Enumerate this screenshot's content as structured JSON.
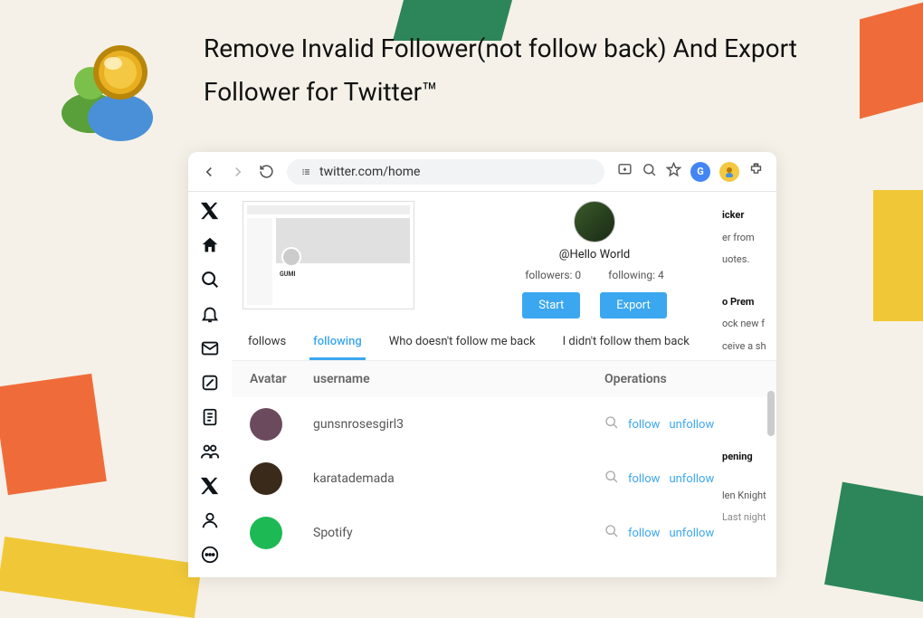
{
  "headline": "Remove Invalid Follower(not follow back) And Export Follower for Twitter™",
  "addressBar": {
    "url": "twitter.com/home"
  },
  "profile": {
    "handle": "@Hello World",
    "followers_label": "followers: 0",
    "following_label": "following: 4",
    "start_btn": "Start",
    "export_btn": "Export"
  },
  "tabs": {
    "follows": "follows",
    "following": "following",
    "who_doesnt": "Who doesn't follow me back",
    "i_didnt": "I didn't follow them back"
  },
  "table": {
    "h_avatar": "Avatar",
    "h_username": "username",
    "h_operations": "Operations",
    "rows": [
      {
        "username": "gunsnrosesgirl3",
        "avatarColor": "#6b4a5e"
      },
      {
        "username": "karatademada",
        "avatarColor": "#3a2a1a"
      },
      {
        "username": "Spotify",
        "avatarColor": "#1db954"
      }
    ],
    "follow_label": "follow",
    "unfollow_label": "unfollow"
  },
  "miniPreview": {
    "name": "GUMI"
  },
  "sideSnippets": {
    "s1a": "icker",
    "s1b": "er from",
    "s1c": "uotes.",
    "s2a": "o Prem",
    "s2b": "ock new f",
    "s2c": "ceive a sh",
    "s3a": "pening",
    "s3b": "len Knight",
    "s3c": "Last night"
  }
}
